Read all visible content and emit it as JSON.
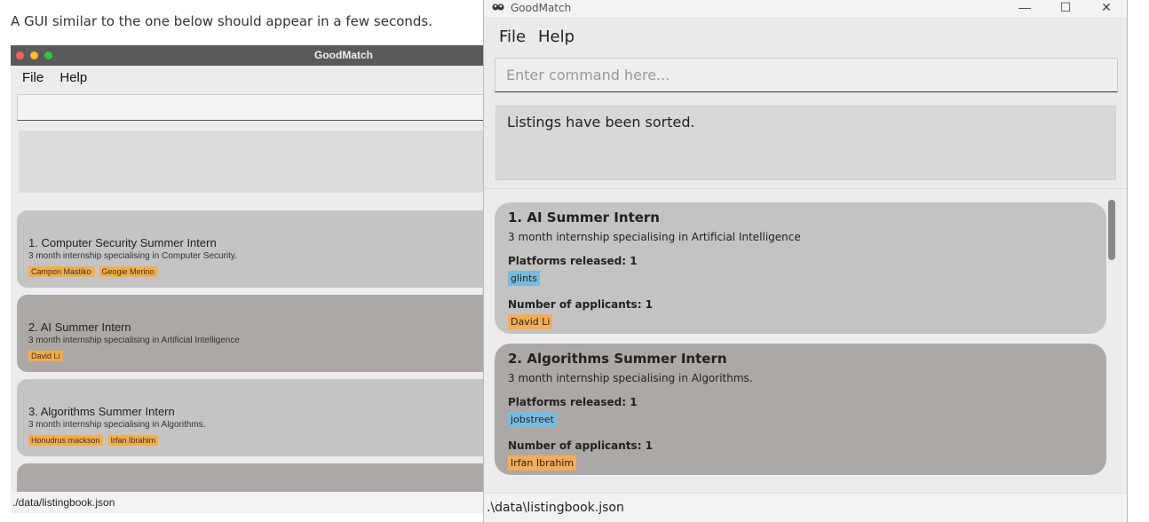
{
  "doc_text": "A GUI similar to the one below should appear in a few seconds.",
  "colors": {
    "tag_orange": "#f6ad56",
    "tag_blue": "#78bbde",
    "card_light": "#c5c3c1",
    "card_dark": "#ada8a5"
  },
  "bg_window": {
    "title": "GoodMatch",
    "menu": [
      "File",
      "Help"
    ],
    "cards": [
      {
        "title": "1.  Computer Security Summer Intern",
        "desc": "3 month internship specialising in Computer Security.",
        "tags": [
          "Campon Mastiko",
          "Geogie Merino"
        ]
      },
      {
        "title": "2.  AI Summer Intern",
        "desc": "3 month internship specialising in Artificial Intelligence",
        "tags": [
          "David Li"
        ]
      },
      {
        "title": "3.  Algorithms Summer Intern",
        "desc": "3 month internship specialising in Algorithms.",
        "tags": [
          "Honudrus mackson",
          "Irfan Ibrahim"
        ]
      }
    ],
    "status": "./data/listingbook.json"
  },
  "app": {
    "icon": "app-icon",
    "title": "GoodMatch",
    "window_buttons": {
      "minimize": "—",
      "maximize": "☐",
      "close": "✕"
    },
    "menu": {
      "file": "File",
      "help": "Help"
    },
    "command": {
      "placeholder": "Enter command here...",
      "value": ""
    },
    "result": "Listings have been sorted.",
    "listings": [
      {
        "title": "1.  AI Summer Intern",
        "desc": "3 month internship specialising in Artificial Intelligence",
        "platforms_label": "Platforms released: 1",
        "platforms": [
          "glints"
        ],
        "applicants_label": "Number of applicants: 1",
        "applicants": [
          "David Li"
        ]
      },
      {
        "title": "2.  Algorithms Summer Intern",
        "desc": "3 month internship specialising in Algorithms.",
        "platforms_label": "Platforms released: 1",
        "platforms": [
          "jobstreet"
        ],
        "applicants_label": "Number of applicants: 1",
        "applicants": [
          "Irfan Ibrahim"
        ]
      }
    ],
    "status": ".\\data\\listingbook.json"
  }
}
